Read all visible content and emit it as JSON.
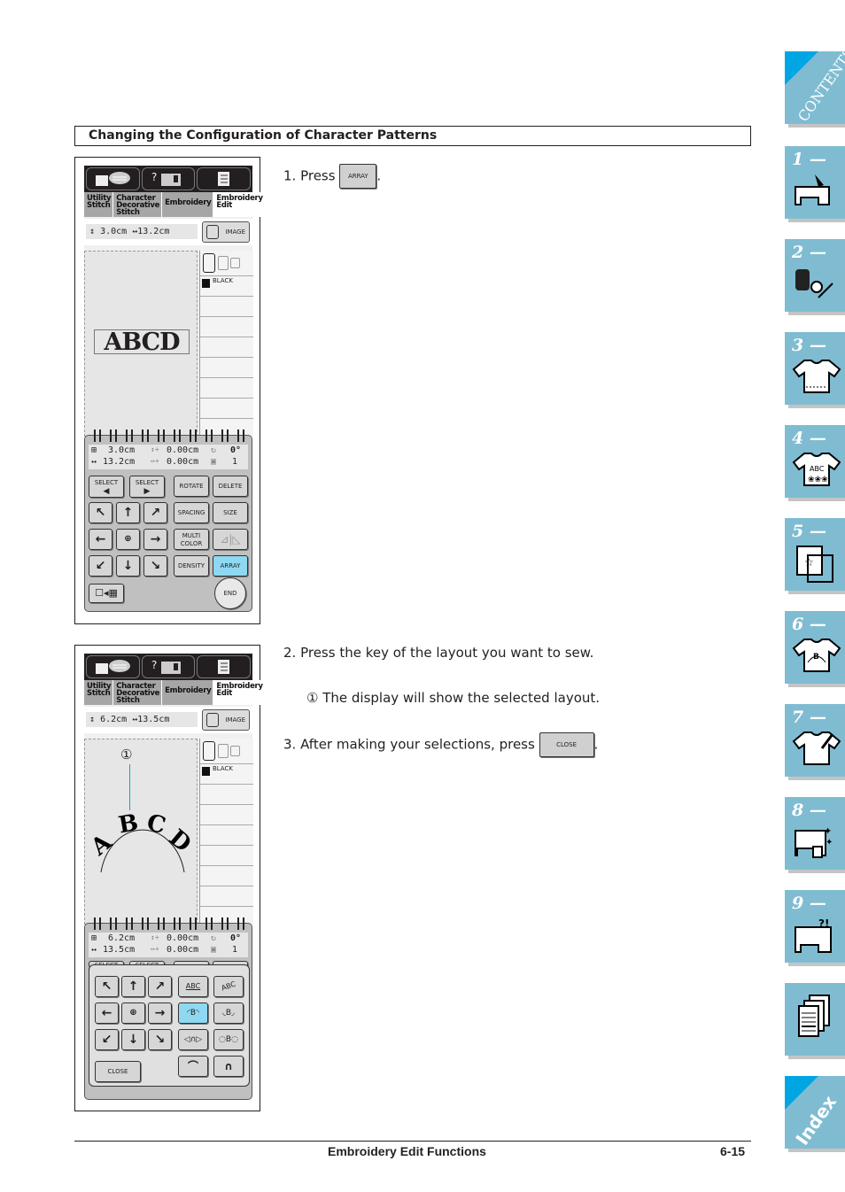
{
  "section_title": "Changing the Configuration of Character Patterns",
  "screen1": {
    "tabs": [
      "Utility Stitch",
      "Character Decorative Stitch",
      "Embroidery",
      "Embroidery Edit"
    ],
    "size_height": "3.0cm",
    "size_width": "13.2cm",
    "image_label": "IMAGE",
    "color_label": "BLACK",
    "pattern_text": "ABCD",
    "info": {
      "height": "3.0cm",
      "width": "13.2cm",
      "vert_offset": "0.00cm",
      "horiz_offset": "0.00cm",
      "angle": "0°",
      "count": "1"
    },
    "keys": {
      "select_prev": "SELECT",
      "select_next": "SELECT",
      "rotate": "ROTATE",
      "delete": "DELETE",
      "spacing": "SPACING",
      "size": "SIZE",
      "multi_color": "MULTI COLOR",
      "density": "DENSITY",
      "array": "ARRAY",
      "end": "END"
    }
  },
  "screen2": {
    "tabs": [
      "Utility Stitch",
      "Character Decorative Stitch",
      "Embroidery",
      "Embroidery Edit"
    ],
    "size_height": "6.2cm",
    "size_width": "13.5cm",
    "image_label": "IMAGE",
    "color_label": "BLACK",
    "pattern_text": "ABCD",
    "callout": "①",
    "info": {
      "height": "6.2cm",
      "width": "13.5cm",
      "vert_offset": "0.00cm",
      "horiz_offset": "0.00cm",
      "angle": "0°",
      "count": "1"
    },
    "keys": {
      "select_prev": "SELECT",
      "select_next": "SELECT",
      "layout_straight": "ABC",
      "layout_slant": "ABC",
      "close": "CLOSE"
    }
  },
  "steps": {
    "s1_prefix": "1.  Press",
    "s1_key": "ARRAY",
    "s1_suffix": ".",
    "s2": "2.  Press the key of the layout you want to sew.",
    "s2_note": "① The display will show the selected layout.",
    "s3_prefix": "3.  After making your selections, press",
    "s3_key": "CLOSE",
    "s3_suffix": "."
  },
  "side_tabs": {
    "contents": "CONTENTS",
    "chapters": [
      "1 —",
      "2 —",
      "3 —",
      "4 —",
      "5 —",
      "6 —",
      "7 —",
      "8 —",
      "9 —"
    ],
    "index": "Index"
  },
  "footer": {
    "title": "Embroidery Edit Functions",
    "page": "6-15"
  }
}
